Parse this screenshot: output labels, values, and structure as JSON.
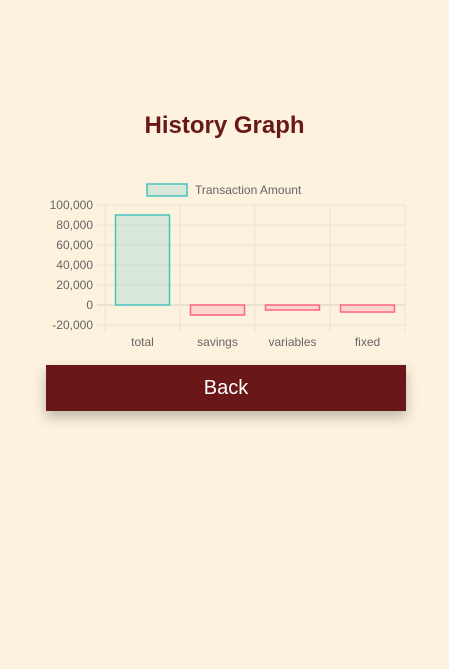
{
  "page": {
    "title": "History Graph"
  },
  "actions": {
    "back_label": "Back"
  },
  "colors": {
    "background": "#fcf2de",
    "accent": "#6a1717",
    "positive_fill": "rgba(75,192,192,0.2)",
    "positive_stroke": "#4bc0c0",
    "negative_fill": "rgba(255,99,132,0.2)",
    "negative_stroke": "#ff6384"
  },
  "chart_data": {
    "type": "bar",
    "categories": [
      "total",
      "savings",
      "variables",
      "fixed"
    ],
    "series": [
      {
        "name": "Transaction Amount",
        "values": [
          90000,
          -10000,
          -5000,
          -7000
        ]
      }
    ],
    "yticks": [
      "100,000",
      "80,000",
      "60,000",
      "40,000",
      "20,000",
      "0",
      "-20,000"
    ],
    "ylim": [
      -20000,
      100000
    ],
    "grid": true,
    "legend": "top"
  }
}
